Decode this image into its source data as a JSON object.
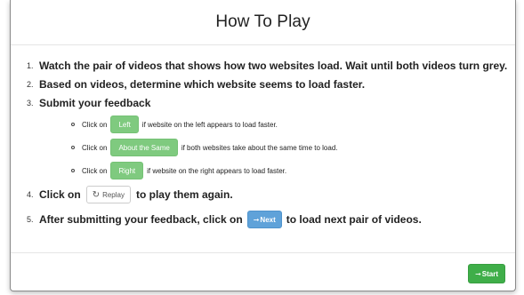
{
  "modal": {
    "title": "How To Play",
    "steps": [
      {
        "num": "1.",
        "text": "Watch the pair of videos that shows how two websites load. Wait until both videos turn grey."
      },
      {
        "num": "2.",
        "text": "Based on videos, determine which website seems to load faster."
      },
      {
        "num": "3.",
        "text": "Submit your feedback"
      },
      {
        "num": "4.",
        "before": "Click on",
        "after": "to play them again."
      },
      {
        "num": "5.",
        "before": "After submitting your feedback, click on",
        "after": "to load next pair of videos."
      }
    ],
    "feedback": [
      {
        "before": "Click on",
        "button": "Left",
        "after": "if website on the left appears to load faster."
      },
      {
        "before": "Click on",
        "button": "About the Same",
        "after": "if both websites take about the same time to load."
      },
      {
        "before": "Click on",
        "button": "Right",
        "after": "if website on the right appears to load faster."
      }
    ],
    "replay_button": {
      "icon": "replay-icon",
      "label": "Replay"
    },
    "next_button": {
      "icon": "arrow-right-icon",
      "label": "Next"
    },
    "start_button": {
      "icon": "arrow-right-icon",
      "label": "Start"
    }
  },
  "colors": {
    "green_button": "#7fca7f",
    "blue_button": "#5fa2d9",
    "start_button": "#3fae49"
  }
}
